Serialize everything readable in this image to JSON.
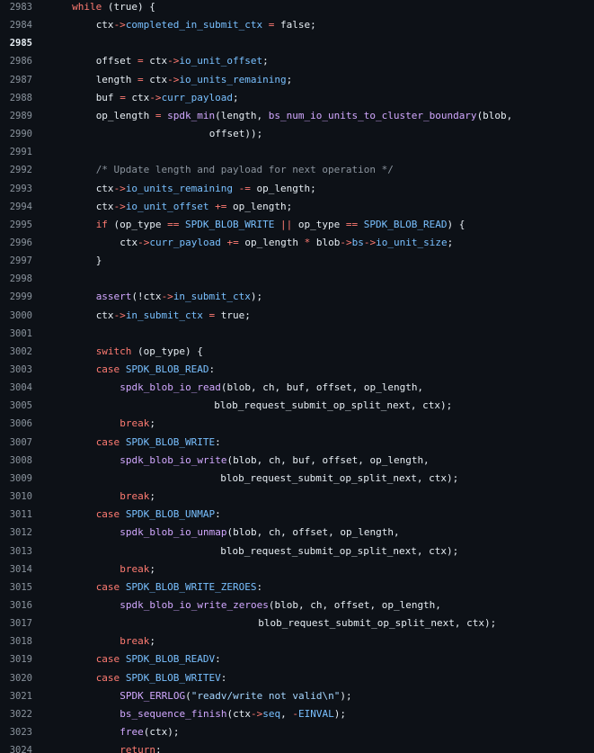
{
  "file_view": {
    "lines": [
      {
        "num": "2983",
        "indent": 2,
        "tokens": [
          [
            "kw",
            "while"
          ],
          [
            "plain",
            " (true) {"
          ]
        ]
      },
      {
        "num": "2984",
        "indent": 4,
        "tokens": [
          [
            "plain",
            "ctx"
          ],
          [
            "op",
            "->"
          ],
          [
            "mem",
            "completed_in_submit_ctx"
          ],
          [
            "plain",
            " "
          ],
          [
            "op",
            "="
          ],
          [
            "plain",
            " false;"
          ]
        ]
      },
      {
        "num": "2985",
        "indent": 0,
        "active": true,
        "tokens": []
      },
      {
        "num": "2986",
        "indent": 4,
        "tokens": [
          [
            "plain",
            "offset "
          ],
          [
            "op",
            "="
          ],
          [
            "plain",
            " ctx"
          ],
          [
            "op",
            "->"
          ],
          [
            "mem",
            "io_unit_offset"
          ],
          [
            "plain",
            ";"
          ]
        ]
      },
      {
        "num": "2987",
        "indent": 4,
        "tokens": [
          [
            "plain",
            "length "
          ],
          [
            "op",
            "="
          ],
          [
            "plain",
            " ctx"
          ],
          [
            "op",
            "->"
          ],
          [
            "mem",
            "io_units_remaining"
          ],
          [
            "plain",
            ";"
          ]
        ]
      },
      {
        "num": "2988",
        "indent": 4,
        "tokens": [
          [
            "plain",
            "buf "
          ],
          [
            "op",
            "="
          ],
          [
            "plain",
            " ctx"
          ],
          [
            "op",
            "->"
          ],
          [
            "mem",
            "curr_payload"
          ],
          [
            "plain",
            ";"
          ]
        ]
      },
      {
        "num": "2989",
        "indent": 4,
        "tokens": [
          [
            "plain",
            "op_length "
          ],
          [
            "op",
            "="
          ],
          [
            "plain",
            " "
          ],
          [
            "fn",
            "spdk_min"
          ],
          [
            "plain",
            "(length, "
          ],
          [
            "fn",
            "bs_num_io_units_to_cluster_boundary"
          ],
          [
            "plain",
            "(blob,"
          ]
        ]
      },
      {
        "num": "2990",
        "indent": 4,
        "extra": 18,
        "tokens": [
          [
            "plain",
            "offset));"
          ]
        ]
      },
      {
        "num": "2991",
        "indent": 0,
        "tokens": []
      },
      {
        "num": "2992",
        "indent": 4,
        "tokens": [
          [
            "cm",
            "/* Update length and payload for next operation */"
          ]
        ]
      },
      {
        "num": "2993",
        "indent": 4,
        "tokens": [
          [
            "plain",
            "ctx"
          ],
          [
            "op",
            "->"
          ],
          [
            "mem",
            "io_units_remaining"
          ],
          [
            "plain",
            " "
          ],
          [
            "op",
            "-="
          ],
          [
            "plain",
            " op_length;"
          ]
        ]
      },
      {
        "num": "2994",
        "indent": 4,
        "tokens": [
          [
            "plain",
            "ctx"
          ],
          [
            "op",
            "->"
          ],
          [
            "mem",
            "io_unit_offset"
          ],
          [
            "plain",
            " "
          ],
          [
            "op",
            "+="
          ],
          [
            "plain",
            " op_length;"
          ]
        ]
      },
      {
        "num": "2995",
        "indent": 4,
        "tokens": [
          [
            "kw",
            "if"
          ],
          [
            "plain",
            " (op_type "
          ],
          [
            "op",
            "=="
          ],
          [
            "plain",
            " "
          ],
          [
            "const",
            "SPDK_BLOB_WRITE"
          ],
          [
            "plain",
            " "
          ],
          [
            "op",
            "||"
          ],
          [
            "plain",
            " op_type "
          ],
          [
            "op",
            "=="
          ],
          [
            "plain",
            " "
          ],
          [
            "const",
            "SPDK_BLOB_READ"
          ],
          [
            "plain",
            ") {"
          ]
        ]
      },
      {
        "num": "2996",
        "indent": 6,
        "tokens": [
          [
            "plain",
            "ctx"
          ],
          [
            "op",
            "->"
          ],
          [
            "mem",
            "curr_payload"
          ],
          [
            "plain",
            " "
          ],
          [
            "op",
            "+="
          ],
          [
            "plain",
            " op_length "
          ],
          [
            "op",
            "*"
          ],
          [
            "plain",
            " blob"
          ],
          [
            "op",
            "->"
          ],
          [
            "mem",
            "bs"
          ],
          [
            "op",
            "->"
          ],
          [
            "mem",
            "io_unit_size"
          ],
          [
            "plain",
            ";"
          ]
        ]
      },
      {
        "num": "2997",
        "indent": 4,
        "tokens": [
          [
            "plain",
            "}"
          ]
        ]
      },
      {
        "num": "2998",
        "indent": 0,
        "tokens": []
      },
      {
        "num": "2999",
        "indent": 4,
        "tokens": [
          [
            "fn",
            "assert"
          ],
          [
            "plain",
            "(!ctx"
          ],
          [
            "op",
            "->"
          ],
          [
            "mem",
            "in_submit_ctx"
          ],
          [
            "plain",
            ");"
          ]
        ]
      },
      {
        "num": "3000",
        "indent": 4,
        "tokens": [
          [
            "plain",
            "ctx"
          ],
          [
            "op",
            "->"
          ],
          [
            "mem",
            "in_submit_ctx"
          ],
          [
            "plain",
            " "
          ],
          [
            "op",
            "="
          ],
          [
            "plain",
            " true;"
          ]
        ]
      },
      {
        "num": "3001",
        "indent": 0,
        "tokens": []
      },
      {
        "num": "3002",
        "indent": 4,
        "tokens": [
          [
            "kw",
            "switch"
          ],
          [
            "plain",
            " (op_type) {"
          ]
        ]
      },
      {
        "num": "3003",
        "indent": 4,
        "tokens": [
          [
            "kw",
            "case"
          ],
          [
            "plain",
            " "
          ],
          [
            "const",
            "SPDK_BLOB_READ"
          ],
          [
            "plain",
            ":"
          ]
        ]
      },
      {
        "num": "3004",
        "indent": 6,
        "tokens": [
          [
            "fn",
            "spdk_blob_io_read"
          ],
          [
            "plain",
            "(blob, ch, buf, offset, op_length,"
          ]
        ]
      },
      {
        "num": "3005",
        "indent": 6,
        "extra": 15,
        "tokens": [
          [
            "plain",
            "blob_request_submit_op_split_next, ctx);"
          ]
        ]
      },
      {
        "num": "3006",
        "indent": 6,
        "tokens": [
          [
            "kw",
            "break"
          ],
          [
            "plain",
            ";"
          ]
        ]
      },
      {
        "num": "3007",
        "indent": 4,
        "tokens": [
          [
            "kw",
            "case"
          ],
          [
            "plain",
            " "
          ],
          [
            "const",
            "SPDK_BLOB_WRITE"
          ],
          [
            "plain",
            ":"
          ]
        ]
      },
      {
        "num": "3008",
        "indent": 6,
        "tokens": [
          [
            "fn",
            "spdk_blob_io_write"
          ],
          [
            "plain",
            "(blob, ch, buf, offset, op_length,"
          ]
        ]
      },
      {
        "num": "3009",
        "indent": 6,
        "extra": 16,
        "tokens": [
          [
            "plain",
            "blob_request_submit_op_split_next, ctx);"
          ]
        ]
      },
      {
        "num": "3010",
        "indent": 6,
        "tokens": [
          [
            "kw",
            "break"
          ],
          [
            "plain",
            ";"
          ]
        ]
      },
      {
        "num": "3011",
        "indent": 4,
        "tokens": [
          [
            "kw",
            "case"
          ],
          [
            "plain",
            " "
          ],
          [
            "const",
            "SPDK_BLOB_UNMAP"
          ],
          [
            "plain",
            ":"
          ]
        ]
      },
      {
        "num": "3012",
        "indent": 6,
        "tokens": [
          [
            "fn",
            "spdk_blob_io_unmap"
          ],
          [
            "plain",
            "(blob, ch, offset, op_length,"
          ]
        ]
      },
      {
        "num": "3013",
        "indent": 6,
        "extra": 16,
        "tokens": [
          [
            "plain",
            "blob_request_submit_op_split_next, ctx);"
          ]
        ]
      },
      {
        "num": "3014",
        "indent": 6,
        "tokens": [
          [
            "kw",
            "break"
          ],
          [
            "plain",
            ";"
          ]
        ]
      },
      {
        "num": "3015",
        "indent": 4,
        "tokens": [
          [
            "kw",
            "case"
          ],
          [
            "plain",
            " "
          ],
          [
            "const",
            "SPDK_BLOB_WRITE_ZEROES"
          ],
          [
            "plain",
            ":"
          ]
        ]
      },
      {
        "num": "3016",
        "indent": 6,
        "tokens": [
          [
            "fn",
            "spdk_blob_io_write_zeroes"
          ],
          [
            "plain",
            "(blob, ch, offset, op_length,"
          ]
        ]
      },
      {
        "num": "3017",
        "indent": 6,
        "extra": 22,
        "tokens": [
          [
            "plain",
            "blob_request_submit_op_split_next, ctx);"
          ]
        ]
      },
      {
        "num": "3018",
        "indent": 6,
        "tokens": [
          [
            "kw",
            "break"
          ],
          [
            "plain",
            ";"
          ]
        ]
      },
      {
        "num": "3019",
        "indent": 4,
        "tokens": [
          [
            "kw",
            "case"
          ],
          [
            "plain",
            " "
          ],
          [
            "const",
            "SPDK_BLOB_READV"
          ],
          [
            "plain",
            ":"
          ]
        ]
      },
      {
        "num": "3020",
        "indent": 4,
        "tokens": [
          [
            "kw",
            "case"
          ],
          [
            "plain",
            " "
          ],
          [
            "const",
            "SPDK_BLOB_WRITEV"
          ],
          [
            "plain",
            ":"
          ]
        ]
      },
      {
        "num": "3021",
        "indent": 6,
        "tokens": [
          [
            "fn",
            "SPDK_ERRLOG"
          ],
          [
            "plain",
            "("
          ],
          [
            "str",
            "\"readv/write not valid\\n\""
          ],
          [
            "plain",
            ");"
          ]
        ]
      },
      {
        "num": "3022",
        "indent": 6,
        "tokens": [
          [
            "fn",
            "bs_sequence_finish"
          ],
          [
            "plain",
            "(ctx"
          ],
          [
            "op",
            "->"
          ],
          [
            "mem",
            "seq"
          ],
          [
            "plain",
            ", "
          ],
          [
            "op",
            "-"
          ],
          [
            "const",
            "EINVAL"
          ],
          [
            "plain",
            ");"
          ]
        ]
      },
      {
        "num": "3023",
        "indent": 6,
        "tokens": [
          [
            "fn",
            "free"
          ],
          [
            "plain",
            "(ctx);"
          ]
        ]
      },
      {
        "num": "3024",
        "indent": 6,
        "tokens": [
          [
            "kw",
            "return"
          ],
          [
            "plain",
            ";"
          ]
        ]
      }
    ]
  },
  "colors": {
    "background": "#0d1117",
    "line_number": "#8b949e",
    "keyword": "#ff7b72",
    "function": "#d2a8ff",
    "constant": "#79c0ff",
    "string": "#a5d6ff",
    "comment": "#8b949e",
    "text": "#e6edf3"
  }
}
